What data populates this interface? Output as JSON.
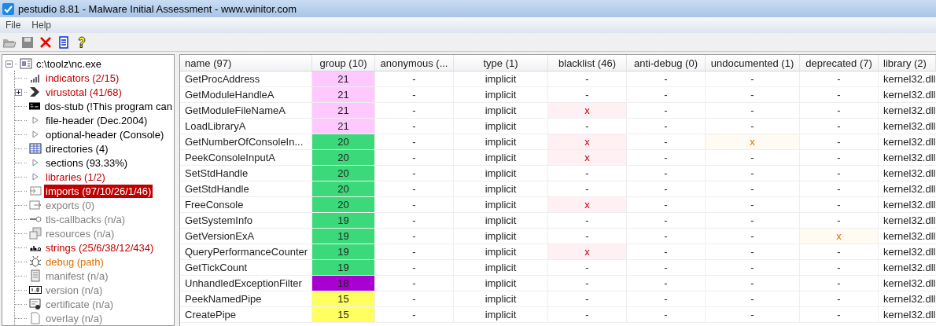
{
  "window": {
    "title": "pestudio 8.81 - Malware Initial Assessment - www.winitor.com"
  },
  "menu": [
    "File",
    "Help"
  ],
  "toolbar": [
    {
      "kind": "open"
    },
    {
      "kind": "save"
    },
    {
      "kind": "close"
    },
    {
      "kind": "list"
    },
    {
      "kind": "help"
    }
  ],
  "tree": {
    "label": "c:\\toolz\\nc.exe",
    "kind": "file",
    "expanded": true,
    "selected": false,
    "color": "#000000",
    "children": [
      {
        "label": "indicators (2/15)",
        "kind": "chart",
        "selected": false,
        "color": "#c00000"
      },
      {
        "label": "virustotal (41/68)",
        "kind": "arrow",
        "expanded": false,
        "selected": false,
        "color": "#c00000"
      },
      {
        "label": "dos-stub (!This program can",
        "kind": "console",
        "selected": false,
        "color": "#000000"
      },
      {
        "label": "file-header (Dec.2004)",
        "kind": "triangle",
        "selected": false,
        "color": "#000000"
      },
      {
        "label": "optional-header (Console)",
        "kind": "triangle",
        "selected": false,
        "color": "#000000"
      },
      {
        "label": "directories (4)",
        "kind": "table",
        "selected": false,
        "color": "#000000"
      },
      {
        "label": "sections (93.33%)",
        "kind": "triangle",
        "selected": false,
        "color": "#000000"
      },
      {
        "label": "libraries (1/2)",
        "kind": "triangle",
        "selected": false,
        "color": "#c00000"
      },
      {
        "label": "imports (97/10/26/1/46)",
        "kind": "import",
        "selected": true,
        "color": "#c00000"
      },
      {
        "label": "exports (0)",
        "kind": "export",
        "selected": false,
        "color": "#808080"
      },
      {
        "label": "tls-callbacks (n/a)",
        "kind": "key",
        "selected": false,
        "color": "#808080"
      },
      {
        "label": "resources (n/a)",
        "kind": "resources",
        "selected": false,
        "color": "#808080"
      },
      {
        "label": "strings (25/6/38/12/434)",
        "kind": "abc",
        "selected": false,
        "color": "#c00000"
      },
      {
        "label": "debug (path)",
        "kind": "bug",
        "selected": false,
        "color": "#e07000"
      },
      {
        "label": "manifest (n/a)",
        "kind": "manifest",
        "selected": false,
        "color": "#808080"
      },
      {
        "label": "version (n/a)",
        "kind": "version",
        "selected": false,
        "color": "#808080"
      },
      {
        "label": "certificate (n/a)",
        "kind": "certificate",
        "selected": false,
        "color": "#808080"
      },
      {
        "label": "overlay (n/a)",
        "kind": "page",
        "selected": false,
        "color": "#808080"
      }
    ]
  },
  "table": {
    "columns": [
      {
        "label": "name (97)",
        "kind": "name"
      },
      {
        "label": "group (10)",
        "kind": "group"
      },
      {
        "label": "anonymous (...",
        "kind": "plain"
      },
      {
        "label": "type (1)",
        "kind": "plain"
      },
      {
        "label": "blacklist (46)",
        "kind": "blacklist"
      },
      {
        "label": "anti-debug (0)",
        "kind": "plain"
      },
      {
        "label": "undocumented (1)",
        "kind": "warn"
      },
      {
        "label": "deprecated (7)",
        "kind": "warn"
      },
      {
        "label": "library (2)",
        "kind": "library"
      }
    ],
    "rows": [
      {
        "cells": [
          {
            "text": "GetProcAddress"
          },
          {
            "text": "21",
            "color": "#ffc8ff"
          },
          {
            "text": "-"
          },
          {
            "text": "implicit"
          },
          {
            "text": "-",
            "flagged": false
          },
          {
            "text": "-"
          },
          {
            "text": "-",
            "flagged": false
          },
          {
            "text": "-",
            "flagged": false
          },
          {
            "text": "kernel32.dll"
          }
        ]
      },
      {
        "cells": [
          {
            "text": "GetModuleHandleA"
          },
          {
            "text": "21",
            "color": "#ffc8ff"
          },
          {
            "text": "-"
          },
          {
            "text": "implicit"
          },
          {
            "text": "-",
            "flagged": false
          },
          {
            "text": "-"
          },
          {
            "text": "-",
            "flagged": false
          },
          {
            "text": "-",
            "flagged": false
          },
          {
            "text": "kernel32.dll"
          }
        ]
      },
      {
        "cells": [
          {
            "text": "GetModuleFileNameA"
          },
          {
            "text": "21",
            "color": "#ffc8ff"
          },
          {
            "text": "-"
          },
          {
            "text": "implicit"
          },
          {
            "text": "x",
            "flagged": true
          },
          {
            "text": "-"
          },
          {
            "text": "-",
            "flagged": false
          },
          {
            "text": "-",
            "flagged": false
          },
          {
            "text": "kernel32.dll"
          }
        ]
      },
      {
        "cells": [
          {
            "text": "LoadLibraryA"
          },
          {
            "text": "21",
            "color": "#ffc8ff"
          },
          {
            "text": "-"
          },
          {
            "text": "implicit"
          },
          {
            "text": "-",
            "flagged": false
          },
          {
            "text": "-"
          },
          {
            "text": "-",
            "flagged": false
          },
          {
            "text": "-",
            "flagged": false
          },
          {
            "text": "kernel32.dll"
          }
        ]
      },
      {
        "cells": [
          {
            "text": "GetNumberOfConsoleIn..."
          },
          {
            "text": "20",
            "color": "#3cd97a"
          },
          {
            "text": "-"
          },
          {
            "text": "implicit"
          },
          {
            "text": "x",
            "flagged": true
          },
          {
            "text": "-"
          },
          {
            "text": "x",
            "flagged": true
          },
          {
            "text": "-",
            "flagged": false
          },
          {
            "text": "kernel32.dll"
          }
        ]
      },
      {
        "cells": [
          {
            "text": "PeekConsoleInputA"
          },
          {
            "text": "20",
            "color": "#3cd97a"
          },
          {
            "text": "-"
          },
          {
            "text": "implicit"
          },
          {
            "text": "x",
            "flagged": true
          },
          {
            "text": "-"
          },
          {
            "text": "-",
            "flagged": false
          },
          {
            "text": "-",
            "flagged": false
          },
          {
            "text": "kernel32.dll"
          }
        ]
      },
      {
        "cells": [
          {
            "text": "SetStdHandle"
          },
          {
            "text": "20",
            "color": "#3cd97a"
          },
          {
            "text": "-"
          },
          {
            "text": "implicit"
          },
          {
            "text": "-",
            "flagged": false
          },
          {
            "text": "-"
          },
          {
            "text": "-",
            "flagged": false
          },
          {
            "text": "-",
            "flagged": false
          },
          {
            "text": "kernel32.dll"
          }
        ]
      },
      {
        "cells": [
          {
            "text": "GetStdHandle"
          },
          {
            "text": "20",
            "color": "#3cd97a"
          },
          {
            "text": "-"
          },
          {
            "text": "implicit"
          },
          {
            "text": "-",
            "flagged": false
          },
          {
            "text": "-"
          },
          {
            "text": "-",
            "flagged": false
          },
          {
            "text": "-",
            "flagged": false
          },
          {
            "text": "kernel32.dll"
          }
        ]
      },
      {
        "cells": [
          {
            "text": "FreeConsole"
          },
          {
            "text": "20",
            "color": "#3cd97a"
          },
          {
            "text": "-"
          },
          {
            "text": "implicit"
          },
          {
            "text": "x",
            "flagged": true
          },
          {
            "text": "-"
          },
          {
            "text": "-",
            "flagged": false
          },
          {
            "text": "-",
            "flagged": false
          },
          {
            "text": "kernel32.dll"
          }
        ]
      },
      {
        "cells": [
          {
            "text": "GetSystemInfo"
          },
          {
            "text": "19",
            "color": "#3cd97a"
          },
          {
            "text": "-"
          },
          {
            "text": "implicit"
          },
          {
            "text": "-",
            "flagged": false
          },
          {
            "text": "-"
          },
          {
            "text": "-",
            "flagged": false
          },
          {
            "text": "-",
            "flagged": false
          },
          {
            "text": "kernel32.dll"
          }
        ]
      },
      {
        "cells": [
          {
            "text": "GetVersionExA"
          },
          {
            "text": "19",
            "color": "#3cd97a"
          },
          {
            "text": "-"
          },
          {
            "text": "implicit"
          },
          {
            "text": "-",
            "flagged": false
          },
          {
            "text": "-"
          },
          {
            "text": "-",
            "flagged": false
          },
          {
            "text": "x",
            "flagged": true
          },
          {
            "text": "kernel32.dll"
          }
        ]
      },
      {
        "cells": [
          {
            "text": "QueryPerformanceCounter"
          },
          {
            "text": "19",
            "color": "#3cd97a"
          },
          {
            "text": "-"
          },
          {
            "text": "implicit"
          },
          {
            "text": "x",
            "flagged": true
          },
          {
            "text": "-"
          },
          {
            "text": "-",
            "flagged": false
          },
          {
            "text": "-",
            "flagged": false
          },
          {
            "text": "kernel32.dll"
          }
        ]
      },
      {
        "cells": [
          {
            "text": "GetTickCount"
          },
          {
            "text": "19",
            "color": "#3cd97a"
          },
          {
            "text": "-"
          },
          {
            "text": "implicit"
          },
          {
            "text": "-",
            "flagged": false
          },
          {
            "text": "-"
          },
          {
            "text": "-",
            "flagged": false
          },
          {
            "text": "-",
            "flagged": false
          },
          {
            "text": "kernel32.dll"
          }
        ]
      },
      {
        "cells": [
          {
            "text": "UnhandledExceptionFilter"
          },
          {
            "text": "18",
            "color": "#a800d0"
          },
          {
            "text": "-"
          },
          {
            "text": "implicit"
          },
          {
            "text": "-",
            "flagged": false
          },
          {
            "text": "-"
          },
          {
            "text": "-",
            "flagged": false
          },
          {
            "text": "-",
            "flagged": false
          },
          {
            "text": "kernel32.dll"
          }
        ]
      },
      {
        "cells": [
          {
            "text": "PeekNamedPipe"
          },
          {
            "text": "15",
            "color": "#ffff60"
          },
          {
            "text": "-"
          },
          {
            "text": "implicit"
          },
          {
            "text": "-",
            "flagged": false
          },
          {
            "text": "-"
          },
          {
            "text": "-",
            "flagged": false
          },
          {
            "text": "-",
            "flagged": false
          },
          {
            "text": "kernel32.dll"
          }
        ]
      },
      {
        "cells": [
          {
            "text": "CreatePipe"
          },
          {
            "text": "15",
            "color": "#ffff60"
          },
          {
            "text": "-"
          },
          {
            "text": "implicit"
          },
          {
            "text": "-",
            "flagged": false
          },
          {
            "text": "-"
          },
          {
            "text": "-",
            "flagged": false
          },
          {
            "text": "-",
            "flagged": false
          },
          {
            "text": "kernel32.dll"
          }
        ]
      }
    ]
  }
}
